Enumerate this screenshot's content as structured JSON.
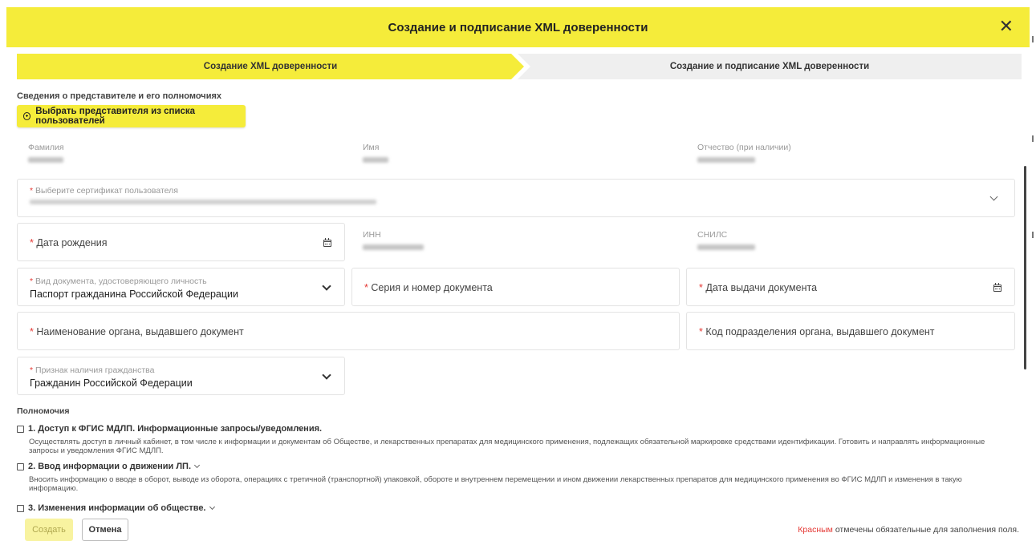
{
  "header": {
    "title": "Создание и подписание XML доверенности",
    "close_icon": "close-icon"
  },
  "steps": [
    {
      "label": "Создание XML доверенности",
      "active": true
    },
    {
      "label": "Создание и подписание XML доверенности",
      "active": false
    }
  ],
  "representative": {
    "section_title": "Сведения о представителе и его полномочиях",
    "select_button": "Выбрать представителя из списка пользователей",
    "surname_label": "Фамилия",
    "name_label": "Имя",
    "patronymic_label": "Отчество (при наличии)"
  },
  "fields": {
    "certificate_label": "Выберите сертификат пользователя",
    "birth_date_placeholder": "Дата рождения",
    "inn_label": "ИНН",
    "snils_label": "СНИЛС",
    "doc_type_label": "Вид документа, удостоверяющего личность",
    "doc_type_value": "Паспорт гражданина Российской Федерации",
    "doc_series_placeholder": "Серия и номер документа",
    "doc_issue_date_placeholder": "Дата выдачи документа",
    "issuer_placeholder": "Наименование органа, выдавшего документ",
    "issuer_code_placeholder": "Код подразделения органа, выдавшего документ",
    "citizenship_label": "Признак наличия гражданства",
    "citizenship_value": "Гражданин Российской Федерации",
    "required_mark": "*"
  },
  "permissions": {
    "title": "Полномочия",
    "items": [
      {
        "title": "1. Доступ к ФГИС МДЛП. Информационные запросы/уведомления.",
        "description": "Осуществлять доступ в личный кабинет, в том числе к информации и документам об Обществе, и лекарственных препаратах для медицинского применения, подлежащих обязательной маркировке средствами идентификации. Готовить и направлять информационные запросы и уведомления ФГИС МДЛП.",
        "checked": false
      },
      {
        "title": "2. Ввод информации о движении ЛП.",
        "description": "Вносить информацию о вводе в оборот, выводе из оборота, операциях с третичной (транспортной) упаковкой, обороте и внутреннем перемещении и ином движении лекарственных препаратов для медицинского применения во ФГИС МДЛП и изменения в такую информацию.",
        "checked": false
      },
      {
        "title": "3. Изменения информации об обществе.",
        "description": "",
        "checked": false
      }
    ]
  },
  "footer": {
    "create_button": "Создать",
    "cancel_button": "Отмена",
    "note_red": "Красным",
    "note_rest": " отмечены обязательные для заполнения поля."
  },
  "colors": {
    "accent": "#f5ec3a",
    "required": "#e53935"
  }
}
